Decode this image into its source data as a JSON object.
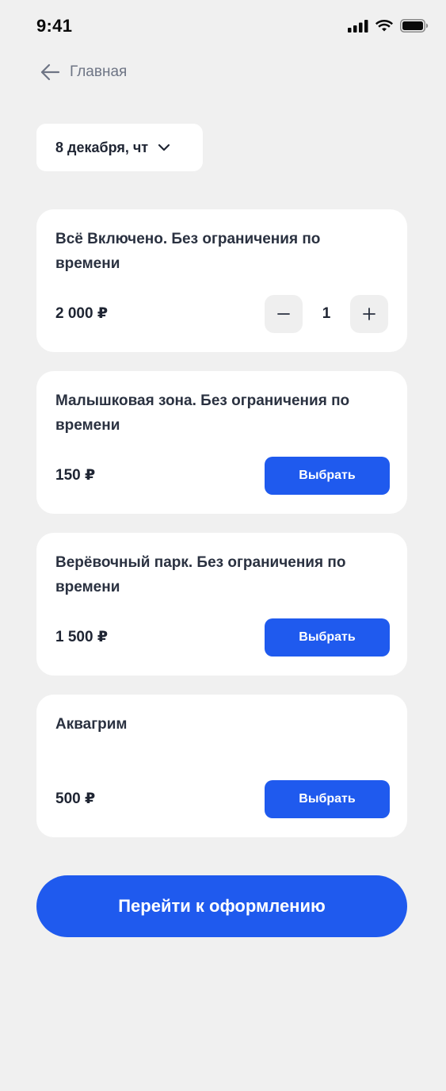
{
  "status_bar": {
    "time": "9:41",
    "icons": [
      "signal-icon",
      "wifi-icon",
      "battery-icon"
    ]
  },
  "nav": {
    "back_label": "Главная",
    "back_icon": "arrow-left-icon"
  },
  "date_picker": {
    "value": "8 декабря, чт",
    "icon": "chevron-down-icon"
  },
  "tickets": [
    {
      "title": "Всё Включено. Без ограничения по времени",
      "price": "2 000 ₽",
      "control": "stepper",
      "quantity": "1"
    },
    {
      "title": "Малышковая зона. Без ограничения по времени",
      "price": "150 ₽",
      "control": "button",
      "button_label": "Выбрать"
    },
    {
      "title": "Верёвочный парк. Без ограничения по времени",
      "price": "1 500 ₽",
      "control": "button",
      "button_label": "Выбрать"
    },
    {
      "title": "Аквагрим",
      "price": "500 ₽",
      "control": "button",
      "button_label": "Выбрать"
    }
  ],
  "checkout": {
    "label": "Перейти к оформлению"
  },
  "colors": {
    "accent": "#1f5aee",
    "background": "#f0f0f0",
    "card": "#ffffff",
    "text_primary": "#1f2533",
    "text_muted": "#6e7585"
  }
}
